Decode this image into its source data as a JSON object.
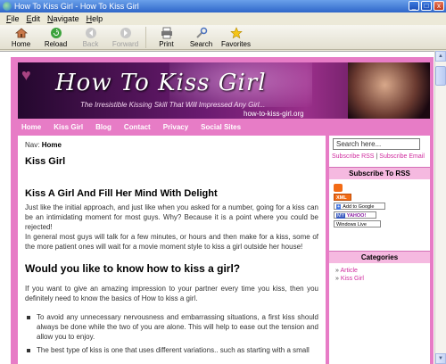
{
  "window": {
    "title": "How To Kiss Girl - How To Kiss Girl",
    "minimize": "_",
    "maximize": "□",
    "close": "x"
  },
  "menu": [
    "File",
    "Edit",
    "Navigate",
    "Help"
  ],
  "toolbar": {
    "home": "Home",
    "reload": "Reload",
    "back": "Back",
    "forward": "Forward",
    "print": "Print",
    "search": "Search",
    "favorites": "Favorites"
  },
  "header": {
    "title": "How To Kiss Girl",
    "tagline": "The Irresistible Kissing Skill That Will Impressed Any Girl...",
    "url": "how-to-kiss-girl.org"
  },
  "nav": [
    "Home",
    "Kiss Girl",
    "Blog",
    "Contact",
    "Privacy",
    "Social Sites"
  ],
  "content": {
    "breadcrumb_prefix": "Nav:",
    "breadcrumb_current": "Home",
    "page_title": "Kiss Girl",
    "section1_heading": "Kiss A Girl And Fill Her Mind With Delight",
    "section1_p1": "Just like the initial approach, and just like when you asked for a number, going for a kiss can be an intimidating moment for most guys. Why? Because it is a point where you could be rejected!",
    "section1_p2": "In general most guys will talk for a few minutes, or hours and then make for a kiss, some of the more patient ones will wait for a movie moment style to kiss a girl outside her house!",
    "section2_heading": "Would you like to know how to kiss a girl?",
    "section2_p1": "If you want to give an amazing impression to your partner every time you kiss, then you definitely need to know the basics of How to kiss a girl.",
    "bullets": [
      "To avoid any unnecessary nervousness and embarrassing situations, a first kiss should always be done while the two of you are alone. This will help to ease out the tension and allow you to enjoy.",
      "The best type of kiss is one that uses different variations.. such as starting with a small"
    ]
  },
  "sidebar": {
    "search_placeholder": "Search here...",
    "subscribe_rss": "Subscribe RSS",
    "link_sep": "|",
    "subscribe_email": "Subscribe Email",
    "rss_heading": "Subscribe To RSS",
    "badges": {
      "xml": "XML",
      "google_plus": "+",
      "google": "Add to Google",
      "yahoo_my": "MY",
      "yahoo": "YAHOO!",
      "live": "Windows Live"
    },
    "categories_heading": "Categories",
    "categories": [
      "Article",
      "Kiss Girl"
    ]
  },
  "colors": {
    "accent_pink": "#e77cc6",
    "link_pink": "#d02c9e",
    "widget_head": "#f5b9e0"
  }
}
